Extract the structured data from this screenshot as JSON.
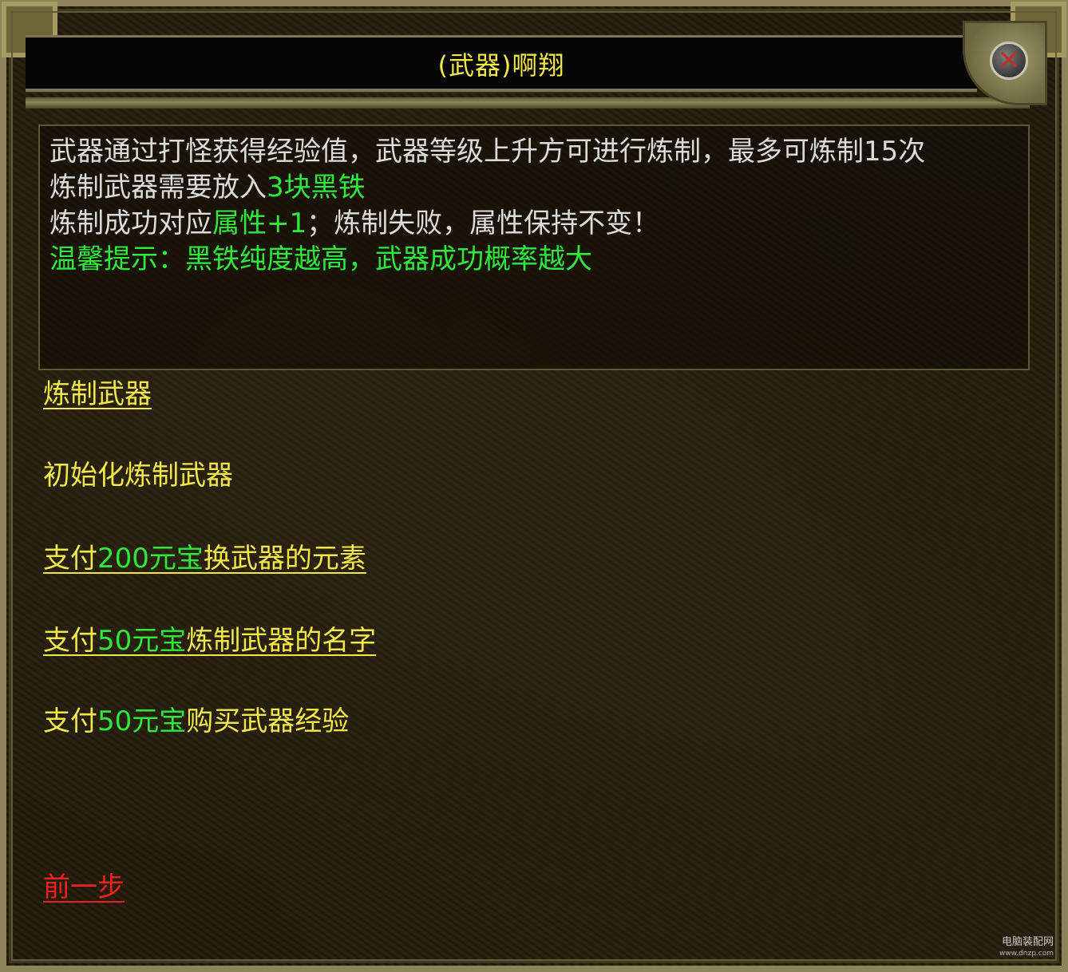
{
  "dialog": {
    "title": "(武器)啊翔",
    "close_symbol": "✕"
  },
  "info": {
    "line1": "武器通过打怪获得经验值，武器等级上升方可进行炼制，最多可炼制15次",
    "line2_prefix": "炼制武器需要放入",
    "line2_highlight": "3块黑铁",
    "line3_prefix": "炼制成功对应",
    "line3_highlight": "属性+1",
    "line3_suffix": "；炼制失败，属性保持不变！",
    "line4": "温馨提示：黑铁纯度越高，武器成功概率越大"
  },
  "options": {
    "refine": "炼制武器",
    "reset": "初始化炼制武器",
    "element_prefix": "支付",
    "element_amount": "200元宝",
    "element_suffix": "换武器的元素",
    "name_prefix": "支付",
    "name_amount": "50元宝",
    "name_suffix": "炼制武器的名字",
    "exp_prefix": "支付",
    "exp_amount": "50元宝",
    "exp_suffix": "购买武器经验",
    "back": "前一步"
  },
  "watermark": {
    "text": "电脑装配网",
    "url": "www.dnzp.com"
  },
  "colors": {
    "yellow": "#f2e84a",
    "green": "#2ee83c",
    "red": "#f0201a",
    "white": "#dcdcdc"
  }
}
